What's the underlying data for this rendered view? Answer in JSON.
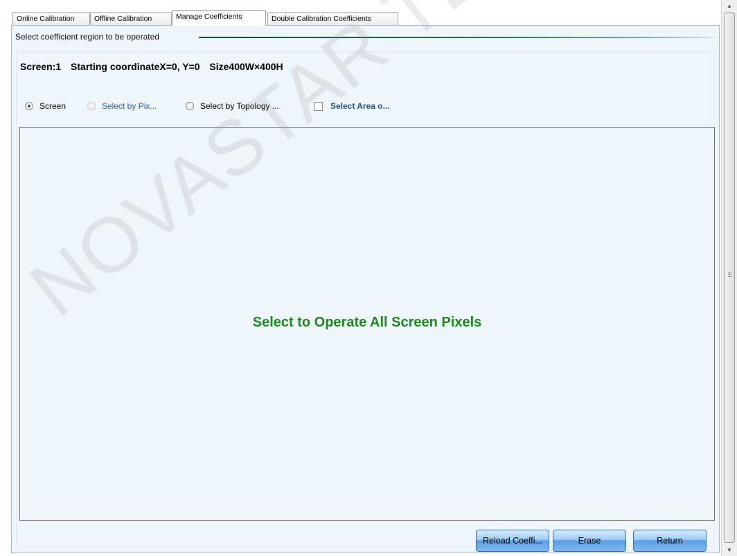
{
  "tabs": [
    {
      "label": "Online Calibration",
      "active": false
    },
    {
      "label": "Offline Calibration",
      "active": false
    },
    {
      "label": "Manage Coefficients",
      "active": true
    },
    {
      "label": "Double Calibration Coefficients",
      "active": false
    }
  ],
  "section": {
    "title": "Select coefficient region to be operated"
  },
  "info": {
    "screen": "Screen:1",
    "start": "Starting coordinateX=0, Y=0",
    "size": "Size400W×400H"
  },
  "options": [
    {
      "label": "Screen",
      "type": "radio",
      "checked": true
    },
    {
      "label": "Select by Pix...",
      "type": "radio",
      "checked": false,
      "disabled": true
    },
    {
      "label": "Select by Topology ...",
      "type": "radio",
      "checked": false
    },
    {
      "label": "Select Area o...",
      "type": "checkbox",
      "checked": false
    }
  ],
  "message": "Select to Operate All Screen Pixels",
  "buttons": {
    "reload": "Reload Coeffi...",
    "erase": "Erase",
    "return": "Return"
  },
  "scrollbar": {
    "up_icon": "arrow-up-icon",
    "down_icon": "arrow-down-icon",
    "grip_icon": "grip-icon"
  },
  "watermark": "NOVASTAR TECH",
  "colors": {
    "message": "#1c8a1c",
    "link": "#2b5fad",
    "panel_bg": "#eef5fb",
    "button": "#7eb9f0"
  }
}
